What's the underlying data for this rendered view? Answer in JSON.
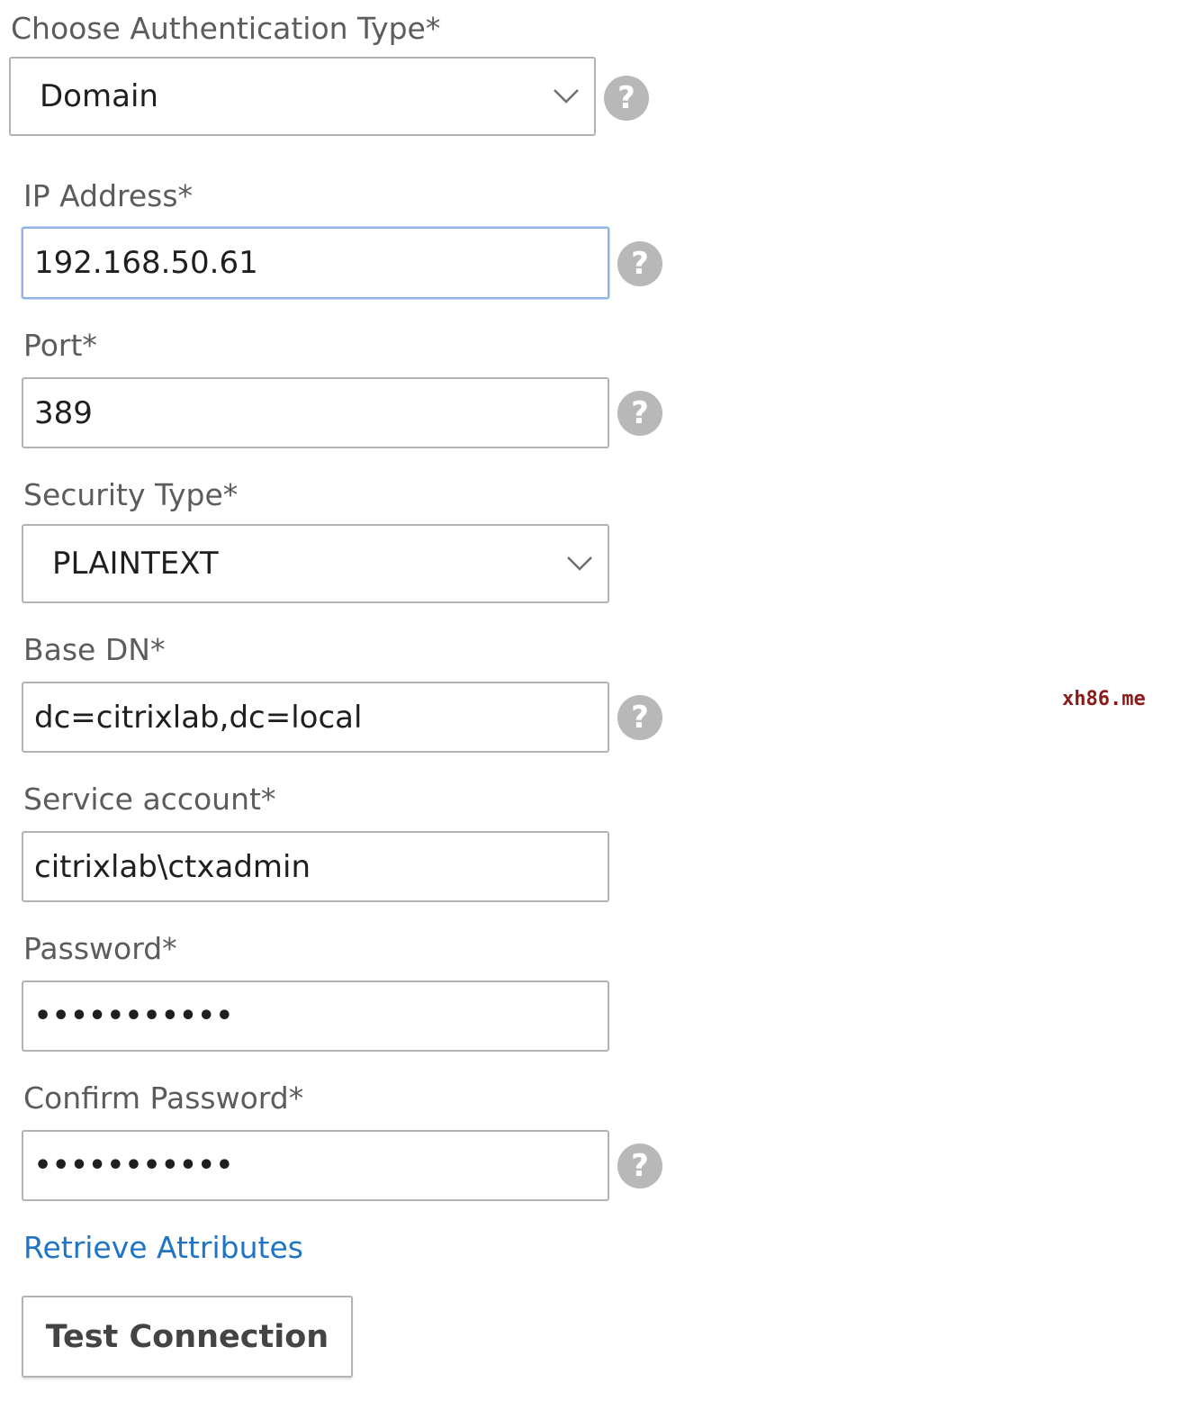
{
  "form": {
    "auth_type": {
      "label": "Choose Authentication Type*",
      "value": "Domain",
      "icon": "chevron-down-icon",
      "help_icon": "?"
    },
    "ip_address": {
      "label": "IP Address*",
      "value": "192.168.50.61",
      "help_icon": "?"
    },
    "port": {
      "label": "Port*",
      "value": "389",
      "help_icon": "?"
    },
    "security_type": {
      "label": "Security Type*",
      "value": "PLAINTEXT",
      "icon": "chevron-down-icon"
    },
    "base_dn": {
      "label": "Base DN*",
      "value": "dc=citrixlab,dc=local",
      "help_icon": "?"
    },
    "service_account": {
      "label": "Service account*",
      "value": "citrixlab\\ctxadmin"
    },
    "password": {
      "label": "Password*",
      "value": "•••••••••••"
    },
    "confirm_password": {
      "label": "Confirm Password*",
      "value": "•••••••••••",
      "help_icon": "?"
    },
    "retrieve_attributes_link": "Retrieve Attributes",
    "test_connection_button": "Test Connection"
  },
  "watermark": {
    "text": "xh86.me",
    "color": "#8b1a1a"
  },
  "colors": {
    "link": "#1f74c4",
    "help_icon_bg": "#b8b8b8",
    "focus_border": "#8fb1e8"
  }
}
